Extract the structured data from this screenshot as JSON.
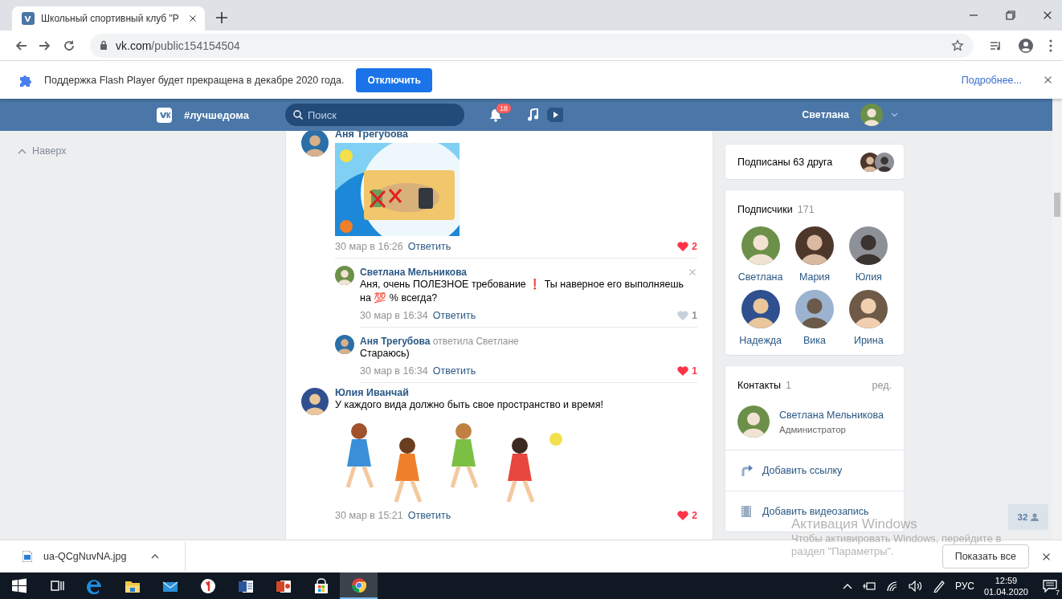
{
  "browser": {
    "tab": {
      "title": "Школьный спортивный клуб \"Р"
    },
    "address": {
      "host": "vk.com",
      "path": "/public154154504"
    }
  },
  "infobar": {
    "message": "Поддержка Flash Player будет прекращена в декабре 2020 года.",
    "button": "Отключить",
    "link": "Подробнее..."
  },
  "header": {
    "title": "#лучшедома",
    "search": {
      "placeholder": "Поиск"
    },
    "notifications": "18",
    "user": "Светлана"
  },
  "sidebar": {
    "up": "Наверх"
  },
  "comments": [
    {
      "author": "Аня Трегубова",
      "date": "30 мар в 16:26",
      "reply": "Ответить",
      "likes": "2",
      "liked": true,
      "replies": [
        {
          "author": "Светлана Мельникова",
          "text": "Аня, очень ПОЛЕЗНОЕ требование ❗ Ты наверное его выполняешь на 💯 % всегда?",
          "date": "30 мар в 16:34",
          "reply": "Ответить",
          "likes": "1",
          "liked": false,
          "hovered": true
        },
        {
          "author": "Аня Трегубова",
          "addressee": "ответила Светлане",
          "text": "Стараюсь)",
          "date": "30 мар в 16:34",
          "reply": "Ответить",
          "likes": "1",
          "liked": true,
          "hovered": false
        }
      ]
    },
    {
      "author": "Юлия Иванчай",
      "text": "У каждого вида должно быть свое пространство и время!",
      "date": "30 мар в 15:21",
      "reply": "Ответить",
      "likes": "2",
      "liked": true
    }
  ],
  "friends": {
    "label": "Подписаны 63 друга"
  },
  "followers": {
    "title": "Подписчики",
    "count": "171",
    "people": [
      "Светлана",
      "Мария",
      "Юлия",
      "Надежда",
      "Вика",
      "Ирина"
    ]
  },
  "contacts": {
    "title": "Контакты",
    "count": "1",
    "edit": "ред.",
    "people": [
      {
        "name": "Светлана Мельникова",
        "role": "Администратор"
      }
    ],
    "actions": [
      {
        "kind": "link",
        "label": "Добавить ссылку"
      },
      {
        "kind": "video",
        "label": "Добавить видеозапись"
      }
    ]
  },
  "online": {
    "count": "32"
  },
  "activation_notice": {
    "title": "Активация Windows",
    "lines": [
      "Чтобы активировать Windows, перейдите в",
      "раздел \"Параметры\"."
    ]
  },
  "downloads": {
    "file": "ua-QCgNuvNA.jpg",
    "show_all": "Показать все"
  },
  "taskbar": {
    "apps": [
      {
        "kind": "start",
        "selected": false
      },
      {
        "kind": "taskview",
        "selected": false
      },
      {
        "kind": "edge",
        "selected": false
      },
      {
        "kind": "explorer",
        "selected": false
      },
      {
        "kind": "mail",
        "selected": false
      },
      {
        "kind": "yandex",
        "selected": false
      },
      {
        "kind": "word",
        "selected": false
      },
      {
        "kind": "powerpoint",
        "selected": false
      },
      {
        "kind": "store",
        "selected": false
      },
      {
        "kind": "chrome",
        "selected": true
      }
    ],
    "language": "РУС",
    "time": "12:59",
    "date": "01.04.2020",
    "notifications": "7"
  }
}
